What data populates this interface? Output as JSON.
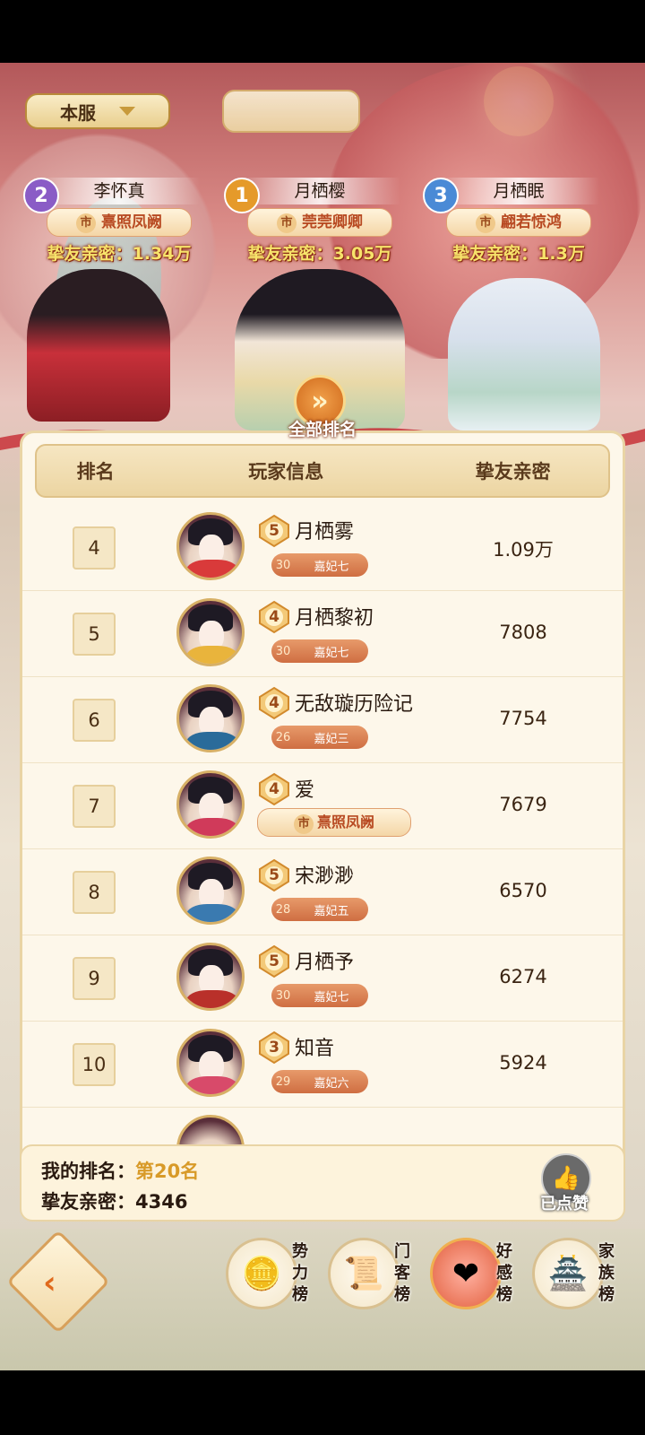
{
  "header": {
    "server_select": "本服"
  },
  "top3": [
    {
      "rank": "2",
      "name": "李怀真",
      "title_tag": "市",
      "title": "熹照凤阙",
      "intimacy": "挚友亲密：1.34万"
    },
    {
      "rank": "1",
      "name": "月栖樱",
      "title_tag": "市",
      "title": "莞莞卿卿",
      "intimacy": "挚友亲密：3.05万"
    },
    {
      "rank": "3",
      "name": "月栖眠",
      "title_tag": "市",
      "title": "翩若惊鸿",
      "intimacy": "挚友亲密：1.3万"
    }
  ],
  "ranking": {
    "section_title": "全部排名",
    "columns": {
      "rank": "排名",
      "player": "玩家信息",
      "score": "挚友亲密"
    },
    "rows": [
      {
        "rank": "4",
        "level": "5",
        "name": "月栖雾",
        "lv": "30",
        "cls": "嘉妃七",
        "score": "1.09万"
      },
      {
        "rank": "5",
        "level": "4",
        "name": "月栖黎初",
        "lv": "30",
        "cls": "嘉妃七",
        "score": "7808"
      },
      {
        "rank": "6",
        "level": "4",
        "name": "无敌璇历险记",
        "lv": "26",
        "cls": "嘉妃三",
        "score": "7754"
      },
      {
        "rank": "7",
        "level": "4",
        "name": "爱",
        "title_tag": "市",
        "title": "熹照凤阙",
        "score": "7679"
      },
      {
        "rank": "8",
        "level": "5",
        "name": "宋渺渺",
        "lv": "28",
        "cls": "嘉妃五",
        "score": "6570"
      },
      {
        "rank": "9",
        "level": "5",
        "name": "月栖予",
        "lv": "30",
        "cls": "嘉妃七",
        "score": "6274"
      },
      {
        "rank": "10",
        "level": "3",
        "name": "知音",
        "lv": "29",
        "cls": "嘉妃六",
        "score": "5924"
      }
    ]
  },
  "my_rank": {
    "rank_label": "我的排名：",
    "rank_value": "第20名",
    "score_label": "挚友亲密：",
    "score_value": "4346",
    "like_label": "已点赞"
  },
  "tabs": [
    {
      "label": "势力榜",
      "icon": "ingot-icon"
    },
    {
      "label": "门客榜",
      "icon": "scroll-icon"
    },
    {
      "label": "好感榜",
      "icon": "heart-icon",
      "active": true
    },
    {
      "label": "家族榜",
      "icon": "mansion-icon"
    }
  ],
  "colors": {
    "accent": "#d06a1c",
    "gold": "#f7e36b",
    "panel": "#fdf7ea"
  }
}
